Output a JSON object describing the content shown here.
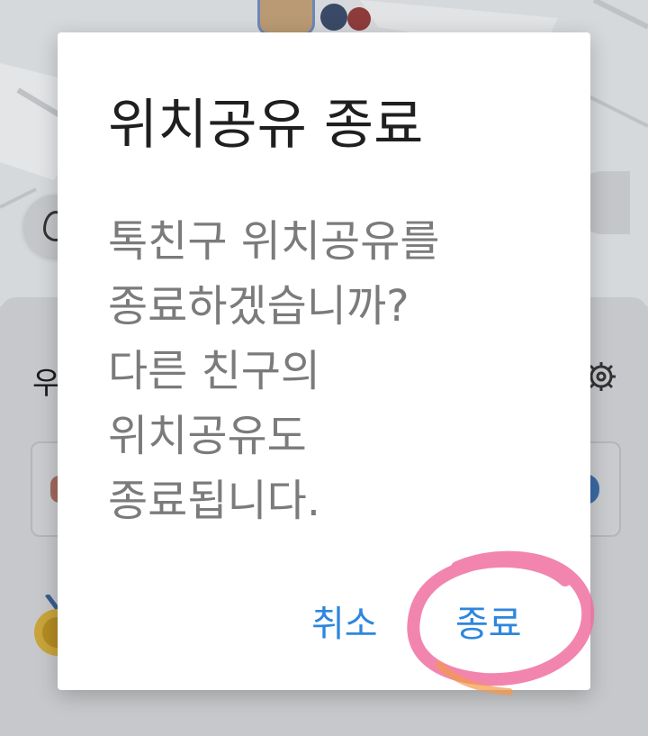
{
  "background": {
    "sheet_title_partial": "우",
    "icons": {
      "location": "location-pin-icon",
      "settings": "gear-icon",
      "medal": "medal-icon"
    }
  },
  "dialog": {
    "title": "위치공유 종료",
    "message_lines": [
      "톡친구 위치공유를",
      "종료하겠습니까?",
      "다른 친구의",
      "위치공유도",
      "종료됩니다."
    ],
    "cancel_label": "취소",
    "confirm_label": "종료"
  },
  "colors": {
    "accent": "#2e86de",
    "highlight": "#f070a0",
    "title": "#1f1f1f",
    "message": "#7b7b7b"
  }
}
